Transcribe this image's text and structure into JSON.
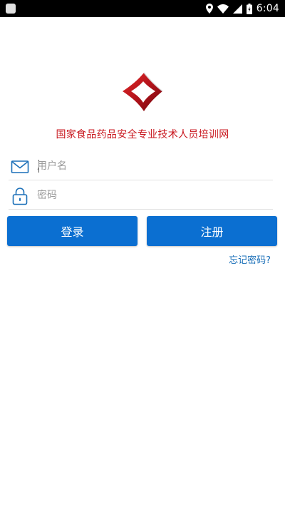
{
  "status_bar": {
    "time": "6:04",
    "icons": [
      "location-icon",
      "wifi-icon",
      "cellular-icon",
      "battery-icon"
    ]
  },
  "site": {
    "title": "国家食品药品安全专业技术人员培训网",
    "title_color": "#c8161d",
    "logo_icon": "red-diamond-logo"
  },
  "login_form": {
    "username_placeholder": "用户名",
    "password_placeholder": "密码",
    "username_icon": "mail-icon",
    "password_icon": "lock-icon"
  },
  "buttons": {
    "login_label": "登录",
    "register_label": "注册",
    "color": "#0b6fd1"
  },
  "links": {
    "forgot_password": "忘记密码?"
  }
}
